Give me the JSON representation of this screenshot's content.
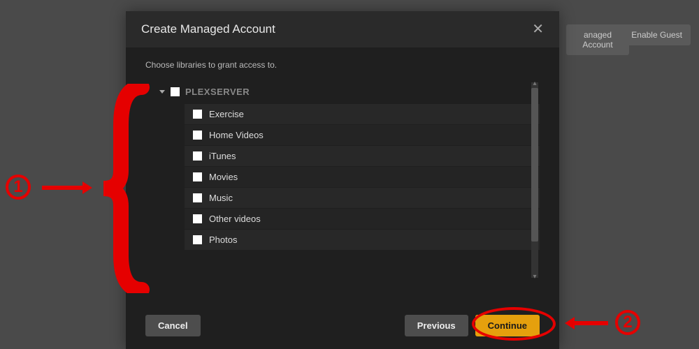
{
  "background": {
    "managed_btn": "anaged Account",
    "guest_btn": "Enable Guest"
  },
  "modal": {
    "title": "Create Managed Account",
    "instructions": "Choose libraries to grant access to.",
    "server_name": "PLEXSERVER",
    "libraries": [
      "Exercise",
      "Home Videos",
      "iTunes",
      "Movies",
      "Music",
      "Other videos",
      "Photos"
    ],
    "buttons": {
      "cancel": "Cancel",
      "previous": "Previous",
      "continue": "Continue"
    }
  },
  "annotations": {
    "step1": "1",
    "step2": "2"
  }
}
